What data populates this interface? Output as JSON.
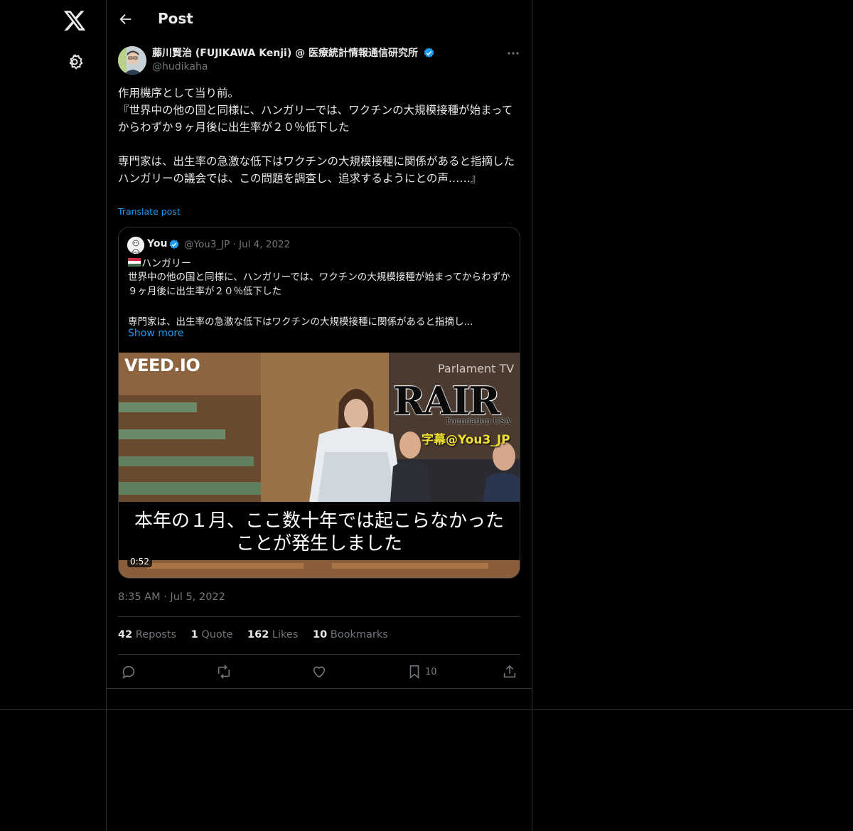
{
  "nav": {
    "logo_icon": "x-logo-icon",
    "settings_icon": "gear-icon"
  },
  "header": {
    "title": "Post",
    "back_icon": "arrow-left-icon"
  },
  "post": {
    "author_name": "藤川賢治 (FUJIKAWA Kenji) @ 医療統計情報通信研究所",
    "handle": "@hudikaha",
    "body": "作用機序として当り前。\n『世界中の他の国と同様に、ハンガリーでは、ワクチンの大規模接種が始まってからわずか９ヶ月後に出生率が２０％低下した\n\n専門家は、出生率の急激な低下はワクチンの大規模接種に関係があると指摘した\nハンガリーの議会では、この問題を調査し、追求するようにとの声……』",
    "translate_label": "Translate post",
    "timestamp": "8:35 AM · Jul 5, 2022",
    "stats": {
      "reposts_count": "42",
      "reposts_label": "Reposts",
      "quotes_count": "1",
      "quotes_label": "Quote",
      "likes_count": "162",
      "likes_label": "Likes",
      "bookmarks_count": "10",
      "bookmarks_label": "Bookmarks"
    },
    "actions": {
      "bookmark_count": "10"
    }
  },
  "quoted": {
    "name": "You",
    "meta": "@You3_JP · Jul 4, 2022",
    "line1": "ハンガリー",
    "text": "世界中の他の国と同様に、ハンガリーでは、ワクチンの大規模接種が始まってからわずか９ヶ月後に出生率が２０％低下した",
    "text_line3": "専門家は、出生率の急激な低下はワクチンの大規模接種に関係があると指摘し...",
    "show_more": "Show more",
    "video": {
      "watermark": "VEED.IO",
      "channel": "Parlament TV",
      "brand": "RAIR",
      "brand_sub": "Foundation USA",
      "credit": "字幕@You3_JP",
      "subtitle_line1": "本年の１月、ここ数十年では起こらなかった",
      "subtitle_line2": "ことが発生しました",
      "duration": "0:52"
    }
  },
  "colors": {
    "background": "#000000",
    "text": "#e7e9ea",
    "muted": "#71767b",
    "accent": "#1d9bf0",
    "border": "#2f3336"
  }
}
